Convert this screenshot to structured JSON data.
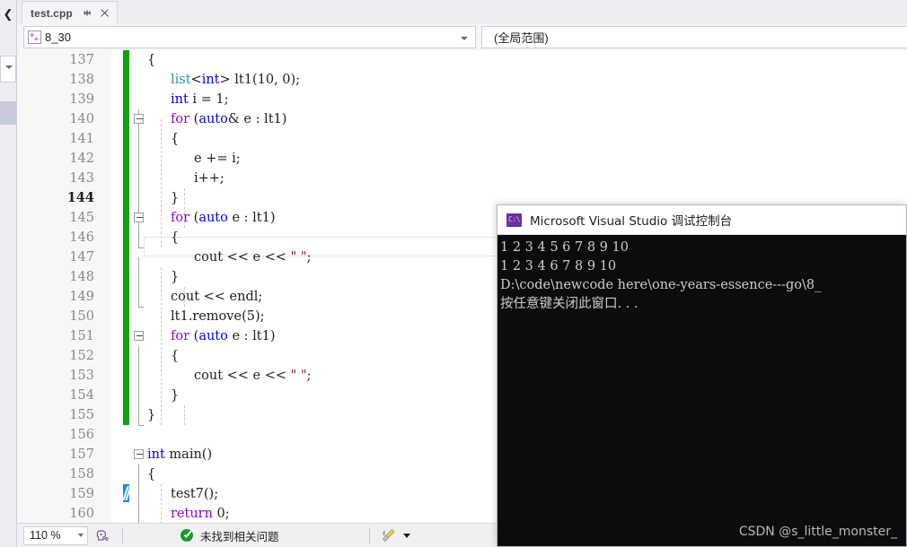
{
  "window": {
    "tab": {
      "title": "test.cpp",
      "pin_icon": "pin-icon",
      "close_icon": "close-icon"
    },
    "rail": {
      "chevron_icon": "chevron-left-icon"
    }
  },
  "navbar": {
    "project_icon": "cpp-project-icon",
    "scope_namespace": "8_30",
    "scope_member": "(全局范围)"
  },
  "editor": {
    "first_line_number": 137,
    "current_line": 144,
    "lines": [
      {
        "n": "137",
        "indent": 0,
        "tokens": [
          {
            "t": "{",
            "c": "plain"
          }
        ]
      },
      {
        "n": "138",
        "indent": 1,
        "tokens": [
          {
            "t": "list",
            "c": "type"
          },
          {
            "t": "<",
            "c": "plain"
          },
          {
            "t": "int",
            "c": "kw"
          },
          {
            "t": "> lt1(10, 0);",
            "c": "plain"
          }
        ]
      },
      {
        "n": "139",
        "indent": 1,
        "tokens": [
          {
            "t": "int",
            "c": "kw"
          },
          {
            "t": " i = 1;",
            "c": "plain"
          }
        ]
      },
      {
        "n": "140",
        "indent": 1,
        "tokens": [
          {
            "t": "for",
            "c": "ctrl"
          },
          {
            "t": " (",
            "c": "plain"
          },
          {
            "t": "auto",
            "c": "kw"
          },
          {
            "t": "& e : lt1)",
            "c": "plain"
          }
        ]
      },
      {
        "n": "141",
        "indent": 1,
        "tokens": [
          {
            "t": "{",
            "c": "plain"
          }
        ]
      },
      {
        "n": "142",
        "indent": 2,
        "tokens": [
          {
            "t": "e += i;",
            "c": "plain"
          }
        ]
      },
      {
        "n": "143",
        "indent": 2,
        "tokens": [
          {
            "t": "i++;",
            "c": "plain"
          }
        ]
      },
      {
        "n": "144",
        "indent": 1,
        "tokens": [
          {
            "t": "}",
            "c": "plain"
          }
        ]
      },
      {
        "n": "145",
        "indent": 1,
        "tokens": [
          {
            "t": "for",
            "c": "ctrl"
          },
          {
            "t": " (",
            "c": "plain"
          },
          {
            "t": "auto",
            "c": "kw"
          },
          {
            "t": " e : lt1)",
            "c": "plain"
          }
        ]
      },
      {
        "n": "146",
        "indent": 1,
        "tokens": [
          {
            "t": "{",
            "c": "plain"
          }
        ]
      },
      {
        "n": "147",
        "indent": 2,
        "tokens": [
          {
            "t": "cout << e << ",
            "c": "plain"
          },
          {
            "t": "\" \"",
            "c": "str"
          },
          {
            "t": ";",
            "c": "plain"
          }
        ]
      },
      {
        "n": "148",
        "indent": 1,
        "tokens": [
          {
            "t": "}",
            "c": "plain"
          }
        ]
      },
      {
        "n": "149",
        "indent": 1,
        "tokens": [
          {
            "t": "cout << endl;",
            "c": "plain"
          }
        ]
      },
      {
        "n": "150",
        "indent": 1,
        "tokens": [
          {
            "t": "lt1.remove(5);",
            "c": "plain"
          }
        ]
      },
      {
        "n": "151",
        "indent": 1,
        "tokens": [
          {
            "t": "for",
            "c": "ctrl"
          },
          {
            "t": " (",
            "c": "plain"
          },
          {
            "t": "auto",
            "c": "kw"
          },
          {
            "t": " e : lt1)",
            "c": "plain"
          }
        ]
      },
      {
        "n": "152",
        "indent": 1,
        "tokens": [
          {
            "t": "{",
            "c": "plain"
          }
        ]
      },
      {
        "n": "153",
        "indent": 2,
        "tokens": [
          {
            "t": "cout << e << ",
            "c": "plain"
          },
          {
            "t": "\" \"",
            "c": "str"
          },
          {
            "t": ";",
            "c": "plain"
          }
        ]
      },
      {
        "n": "154",
        "indent": 1,
        "tokens": [
          {
            "t": "}",
            "c": "plain"
          }
        ]
      },
      {
        "n": "155",
        "indent": 0,
        "tokens": [
          {
            "t": "}",
            "c": "plain"
          }
        ]
      },
      {
        "n": "156",
        "indent": 0,
        "tokens": []
      },
      {
        "n": "157",
        "indent": 0,
        "tokens": [
          {
            "t": "int",
            "c": "kw"
          },
          {
            "t": " main()",
            "c": "plain"
          }
        ]
      },
      {
        "n": "158",
        "indent": 0,
        "tokens": [
          {
            "t": "{",
            "c": "plain"
          }
        ]
      },
      {
        "n": "159",
        "indent": 1,
        "tokens": [
          {
            "t": "test7();",
            "c": "plain"
          }
        ]
      },
      {
        "n": "160",
        "indent": 1,
        "tokens": [
          {
            "t": "return",
            "c": "ctrl"
          },
          {
            "t": " 0;",
            "c": "plain"
          }
        ]
      }
    ]
  },
  "statusbar": {
    "zoom": "110 %",
    "head_icon": "intellicode-icon",
    "ok_icon": "check-circle-icon",
    "message": "未找到相关问题",
    "broom_icon": "broom-icon",
    "broom_arrow_icon": "chevron-down-icon"
  },
  "console": {
    "icon": "console-app-icon",
    "icon_text": "C:\\",
    "title": "Microsoft Visual Studio 调试控制台",
    "output": "1 2 3 4 5 6 7 8 9 10\n1 2 3 4 6 7 8 9 10\nD:\\code\\newcode here\\one-years-essence---go\\8_\n按任意键关闭此窗口. . .",
    "watermark": "CSDN @s_little_monster_"
  },
  "colors": {
    "keyword": "#0000ff",
    "control": "#8f08c4",
    "type": "#2b91af",
    "string": "#a31515",
    "change_bar": "#10a010",
    "edit_bar": "#1e8ad6",
    "console_bg": "#0c0c0c",
    "chrome": "#eeeef2"
  }
}
